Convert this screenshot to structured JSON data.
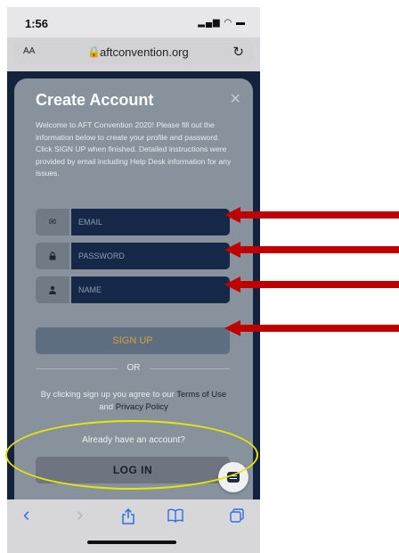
{
  "status_bar": {
    "time": "1:56",
    "icons": "▂▄▆ ◠ ▬"
  },
  "browser": {
    "text_size_label": "AA",
    "url": "aftconvention.org",
    "reload_icon": "↻",
    "lock_icon": "🔒"
  },
  "modal": {
    "title": "Create Account",
    "close_icon": "×",
    "description": "Welcome to AFT Convention 2020! Please fill out the information below to create your profile and password. Click SIGN UP when finished. Detailed instructions were provided by email including Help Desk information for any issues.",
    "fields": [
      {
        "icon": "envelope-icon",
        "glyph": "✉",
        "placeholder": "EMAIL"
      },
      {
        "icon": "lock-icon",
        "glyph": "🔒",
        "placeholder": "PASSWORD"
      },
      {
        "icon": "user-icon",
        "glyph": "👤",
        "placeholder": "NAME"
      }
    ],
    "signup_label": "SIGN UP",
    "or_label": "OR",
    "terms_prefix": "By clicking sign up you agree to our ",
    "terms_link": "Terms of Use",
    "terms_and": " and ",
    "privacy_link": "Privacy Policy",
    "already_text": "Already have an account?",
    "login_label": "LOG IN"
  },
  "toolbar": {
    "back": "‹",
    "forward": "›",
    "share": "⇪",
    "bookmarks": "📖",
    "tabs": "❐"
  },
  "colors": {
    "page_bg": "#14223e",
    "modal_bg": "#87929d",
    "accent": "#d4a035",
    "arrow": "#c00000",
    "highlight": "#e7e600"
  }
}
